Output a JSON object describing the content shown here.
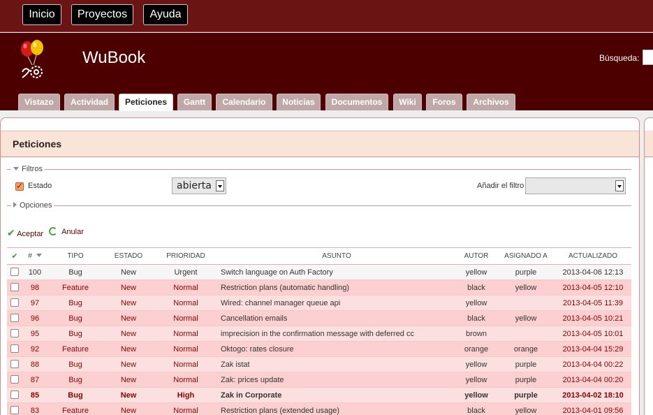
{
  "top_menu": [
    "Inicio",
    "Proyectos",
    "Ayuda"
  ],
  "header": {
    "title": "WuBook",
    "search_label": "Búsqueda:"
  },
  "tabs": [
    {
      "label": "Vistazo"
    },
    {
      "label": "Actividad"
    },
    {
      "label": "Peticiones",
      "selected": true
    },
    {
      "label": "Gantt"
    },
    {
      "label": "Calendario"
    },
    {
      "label": "Noticias"
    },
    {
      "label": "Documentos"
    },
    {
      "label": "Wiki"
    },
    {
      "label": "Foros"
    },
    {
      "label": "Archivos"
    }
  ],
  "page": {
    "title": "Peticiones",
    "filters_legend": "Filtros",
    "options_legend": "Opciones",
    "filter_status_label": "Estado",
    "filter_status_value": "abierta",
    "add_filter_label": "Añadir el filtro",
    "apply_label": "Aceptar",
    "reset_label": "Anular"
  },
  "table": {
    "columns": [
      "#",
      "TIPO",
      "ESTADO",
      "PRIORIDAD",
      "ASUNTO",
      "AUTOR",
      "ASIGNADO A",
      "ACTUALIZADO"
    ],
    "rows": [
      {
        "id": "100",
        "tracker": "Bug",
        "status": "New",
        "priority": "Urgent",
        "subject": "Switch language on Auth Factory",
        "author": "yellow",
        "assignee": "purple",
        "updated": "2013-04-06 12:13"
      },
      {
        "id": "98",
        "tracker": "Feature",
        "status": "New",
        "priority": "Normal",
        "subject": "Restriction plans (automatic handling)",
        "author": "black",
        "assignee": "yellow",
        "updated": "2013-04-05 12:10"
      },
      {
        "id": "97",
        "tracker": "Bug",
        "status": "New",
        "priority": "Normal",
        "subject": "Wired: channel manager queue api",
        "author": "yellow",
        "assignee": "",
        "updated": "2013-04-05 11:39"
      },
      {
        "id": "96",
        "tracker": "Bug",
        "status": "New",
        "priority": "Normal",
        "subject": "Cancellation emails",
        "author": "black",
        "assignee": "yellow",
        "updated": "2013-04-05 10:21"
      },
      {
        "id": "95",
        "tracker": "Bug",
        "status": "New",
        "priority": "Normal",
        "subject": "imprecision in the confirmation message with deferred cc",
        "author": "brown",
        "assignee": "",
        "updated": "2013-04-05 10:01"
      },
      {
        "id": "92",
        "tracker": "Feature",
        "status": "New",
        "priority": "Normal",
        "subject": "Oktogo: rates closure",
        "author": "orange",
        "assignee": "orange",
        "updated": "2013-04-04 15:29"
      },
      {
        "id": "88",
        "tracker": "Bug",
        "status": "New",
        "priority": "Normal",
        "subject": "Zak istat",
        "author": "yellow",
        "assignee": "purple",
        "updated": "2013-04-04 00:22"
      },
      {
        "id": "87",
        "tracker": "Bug",
        "status": "New",
        "priority": "Normal",
        "subject": "Zak: prices update",
        "author": "yellow",
        "assignee": "purple",
        "updated": "2013-04-04 00:20"
      },
      {
        "id": "85",
        "tracker": "Bug",
        "status": "New",
        "priority": "High",
        "subject": "Zak in Corporate",
        "author": "yellow",
        "assignee": "purple",
        "updated": "2013-04-02 18:10"
      },
      {
        "id": "83",
        "tracker": "Feature",
        "status": "New",
        "priority": "Normal",
        "subject": "Restriction plans (extended usage)",
        "author": "black",
        "assignee": "yellow",
        "updated": "2013-04-01 09:56"
      }
    ]
  },
  "colors": {
    "top_bar": "#6b1414",
    "header": "#4d0000",
    "title_band": "#fae3d7",
    "row_bg": "#fcd0d0"
  }
}
